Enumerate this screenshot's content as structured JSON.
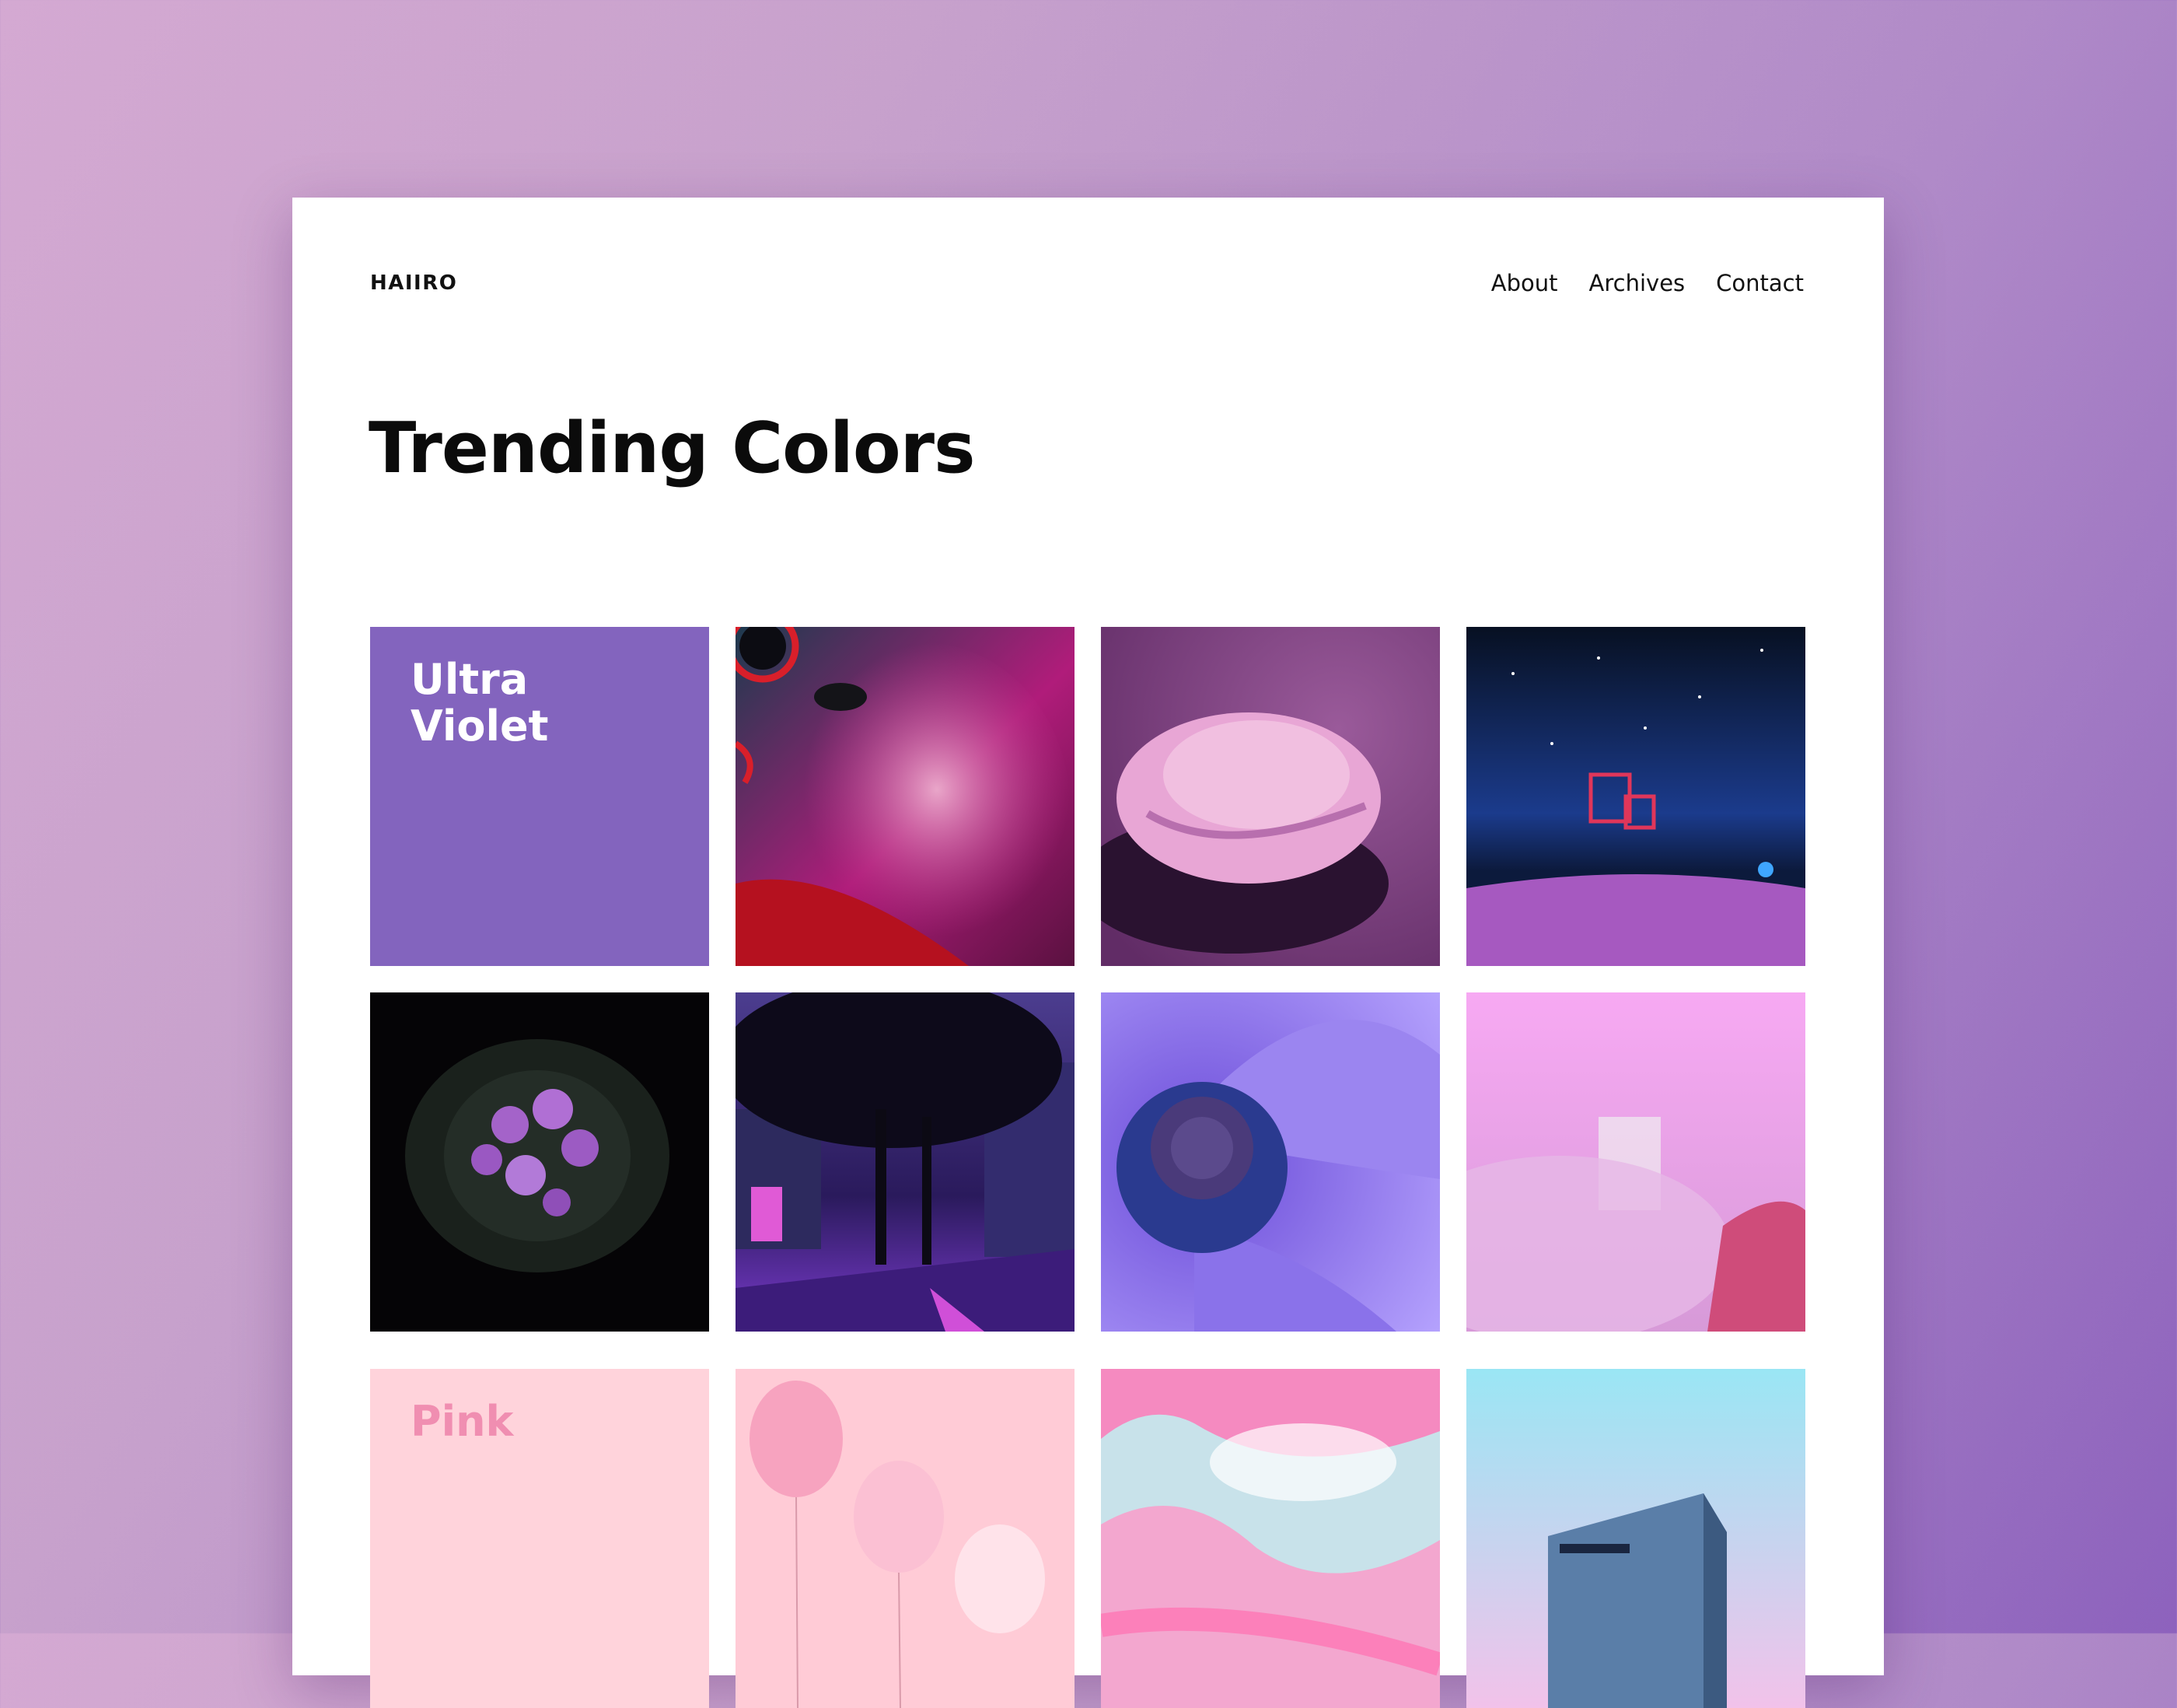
{
  "site": {
    "logo": "HAIIRO"
  },
  "nav": {
    "items": [
      "About",
      "Archives",
      "Contact"
    ]
  },
  "page": {
    "title": "Trending Colors"
  },
  "swatches": [
    {
      "label": "Ultra Violet",
      "background": "#8364be",
      "text_color": "#ffffff"
    },
    {
      "label": "Pink",
      "background": "#ffd3db",
      "text_color": "#f08eb1"
    }
  ],
  "colors": {
    "ultra_violet": "#8364be",
    "pink": "#ffd3db",
    "pink_text": "#f08eb1",
    "page_background": "#ffffff"
  }
}
